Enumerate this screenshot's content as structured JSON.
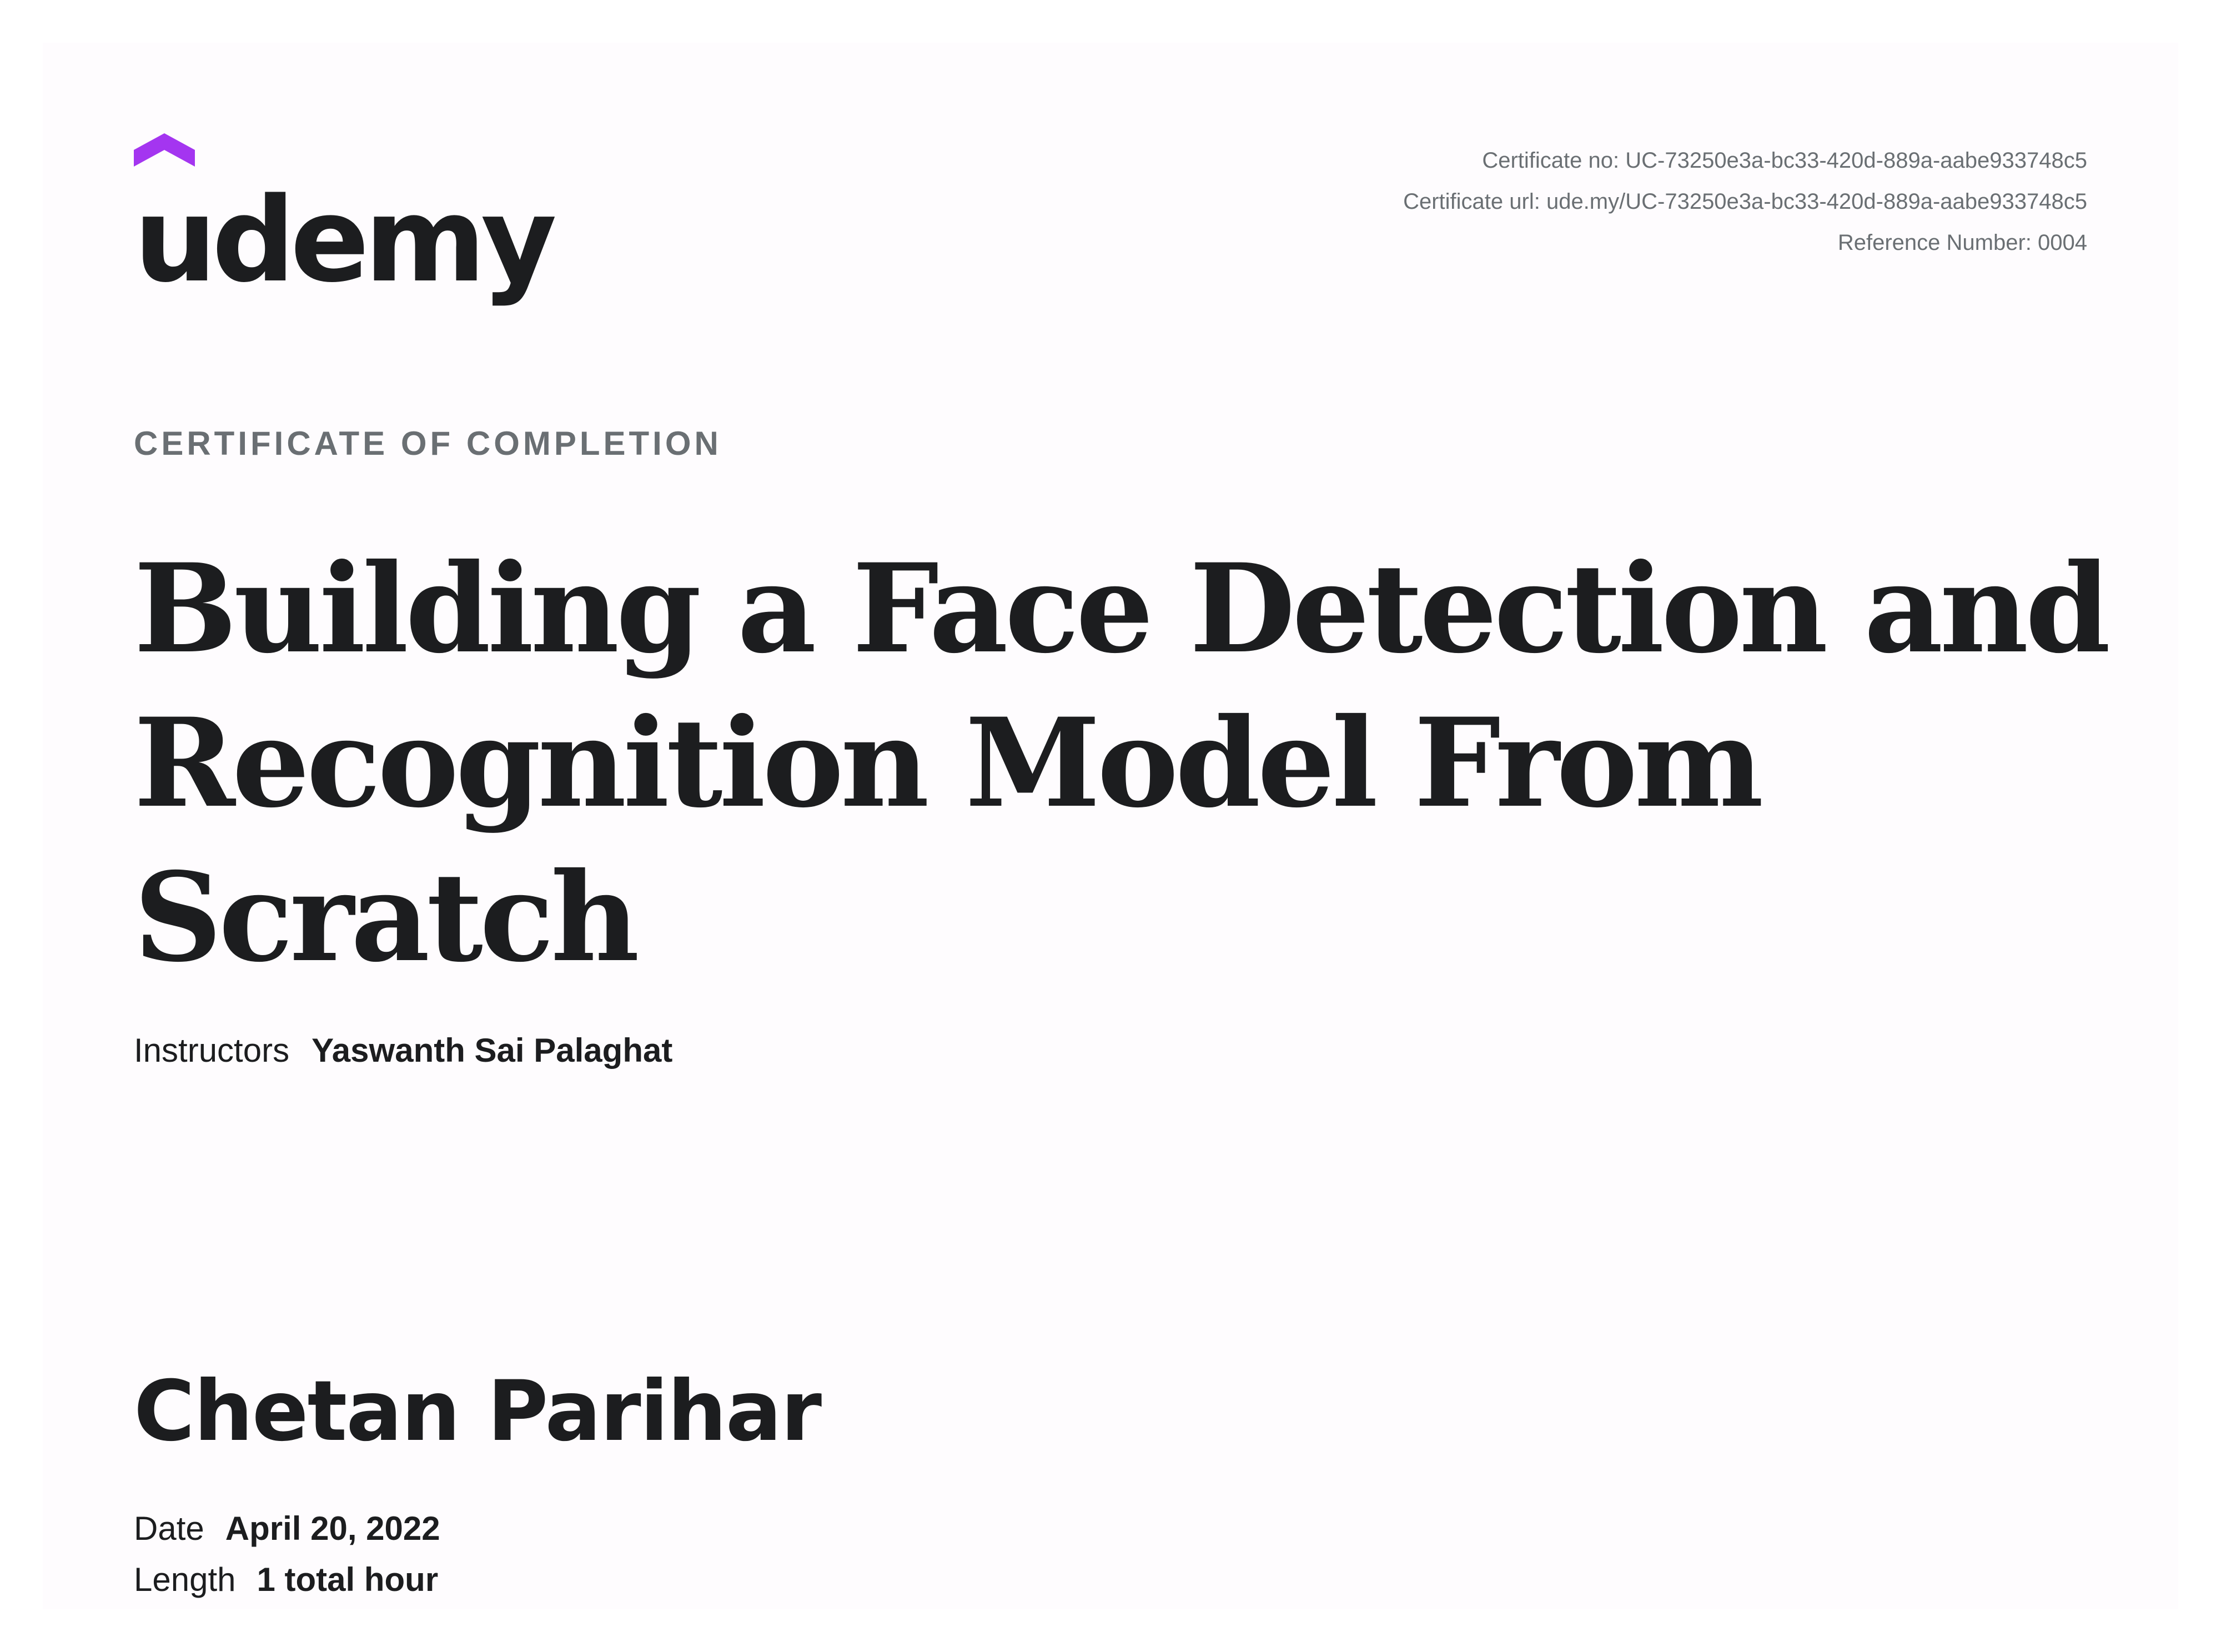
{
  "brand": {
    "logo_text": "udemy",
    "accent_color": "#a435f0",
    "text_color": "#1c1d1f"
  },
  "meta": {
    "certificate_no": "Certificate no: UC-73250e3a-bc33-420d-889a-aabe933748c5",
    "certificate_url": "Certificate url: ude.my/UC-73250e3a-bc33-420d-889a-aabe933748c5",
    "reference_number": "Reference Number: 0004"
  },
  "certificate": {
    "heading": "CERTIFICATE OF COMPLETION",
    "course_title_lines": [
      "Building a Face Detection and",
      "Recognition Model From",
      "Scratch"
    ],
    "instructors_label": "Instructors",
    "instructor_name": "Yaswanth Sai Palaghat",
    "recipient_name": "Chetan Parihar",
    "date_label": "Date",
    "date_value": "April 20, 2022",
    "length_label": "Length",
    "length_value": "1 total hour"
  }
}
